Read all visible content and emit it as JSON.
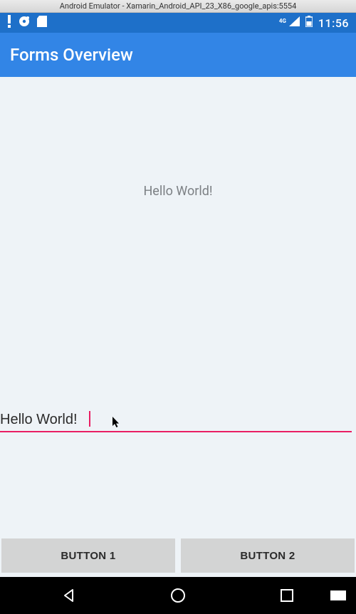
{
  "emulator": {
    "window_title": "Android Emulator - Xamarin_Android_API_23_X86_google_apis:5554"
  },
  "statusbar": {
    "network_label": "4G",
    "clock": "11:56"
  },
  "appbar": {
    "title": "Forms Overview"
  },
  "content": {
    "center_label": "Hello World!",
    "entry_value": "Hello World!"
  },
  "buttons": {
    "button1": "BUTTON 1",
    "button2": "BUTTON 2"
  }
}
